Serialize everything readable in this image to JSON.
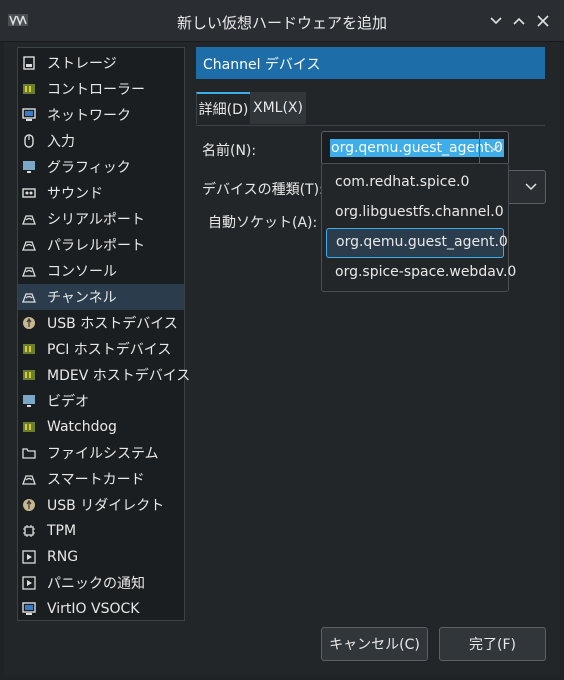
{
  "window": {
    "title": "新しい仮想ハードウェアを追加"
  },
  "sidebar": {
    "selected_index": 9,
    "items": [
      {
        "label": "ストレージ",
        "icon": "disk-icon"
      },
      {
        "label": "コントローラー",
        "icon": "controller-icon"
      },
      {
        "label": "ネットワーク",
        "icon": "network-icon"
      },
      {
        "label": "入力",
        "icon": "mouse-icon"
      },
      {
        "label": "グラフィック",
        "icon": "display-icon"
      },
      {
        "label": "サウンド",
        "icon": "sound-icon"
      },
      {
        "label": "シリアルポート",
        "icon": "serial-port-icon"
      },
      {
        "label": "パラレルポート",
        "icon": "parallel-port-icon"
      },
      {
        "label": "コンソール",
        "icon": "console-icon"
      },
      {
        "label": "チャンネル",
        "icon": "channel-icon"
      },
      {
        "label": "USB ホストデバイス",
        "icon": "usb-icon"
      },
      {
        "label": "PCI ホストデバイス",
        "icon": "pci-icon"
      },
      {
        "label": "MDEV ホストデバイス",
        "icon": "mdev-icon"
      },
      {
        "label": "ビデオ",
        "icon": "video-icon"
      },
      {
        "label": "Watchdog",
        "icon": "watchdog-icon"
      },
      {
        "label": "ファイルシステム",
        "icon": "folder-icon"
      },
      {
        "label": "スマートカード",
        "icon": "smartcard-icon"
      },
      {
        "label": "USB リダイレクト",
        "icon": "usb-redirect-icon"
      },
      {
        "label": "TPM",
        "icon": "tpm-icon"
      },
      {
        "label": "RNG",
        "icon": "rng-icon"
      },
      {
        "label": "パニックの通知",
        "icon": "panic-icon"
      },
      {
        "label": "VirtIO VSOCK",
        "icon": "vsock-icon"
      }
    ]
  },
  "main": {
    "header": "Channel デバイス",
    "tabs": [
      {
        "label": "詳細(D)",
        "active": true
      },
      {
        "label": "XML(X)",
        "active": false
      }
    ],
    "fields": {
      "name_label": "名前(N):",
      "name_value": "org.qemu.guest_agent.0",
      "device_type_label": "デバイスの種類(T):",
      "auto_socket_label": "自動ソケット(A):"
    },
    "dropdown": {
      "options": [
        "com.redhat.spice.0",
        "org.libguestfs.channel.0",
        "org.qemu.guest_agent.0",
        "org.spice-space.webdav.0"
      ],
      "selected_index": 2
    }
  },
  "buttons": {
    "cancel": "キャンセル(C)",
    "finish": "完了(F)"
  },
  "colors": {
    "accent": "#3daee9",
    "header_bg": "#1d6ea8",
    "selection_bg": "#2b3d4d",
    "window_bg": "#222629"
  }
}
